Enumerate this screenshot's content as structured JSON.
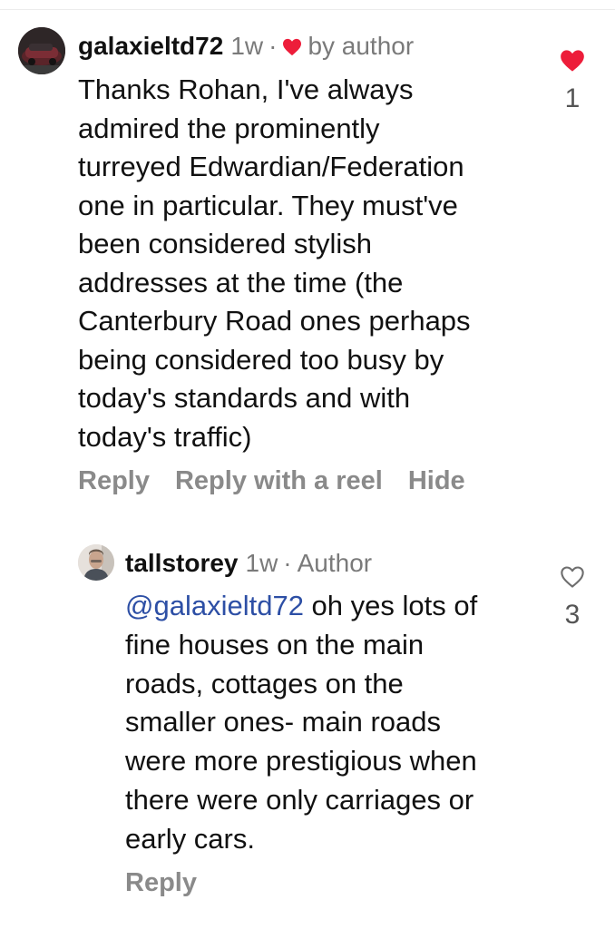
{
  "colors": {
    "like_active": "#ed1d3a",
    "secondary_text": "#7a7a7a",
    "mention_link": "#2d4fa5"
  },
  "comments": [
    {
      "username": "galaxieltd72",
      "time": "1w",
      "separator": "·",
      "author_like_icon": "heart-filled-icon",
      "author_like_label": "by author",
      "body_lines": [
        "Thanks Rohan, I've always",
        "admired the prominently",
        "turreyed Edwardian/Federation",
        "one in particular. They must've",
        "been considered stylish",
        "addresses at the time (the",
        "Canterbury Road ones perhaps",
        "being considered too busy by",
        "today's standards and with",
        "today's traffic)"
      ],
      "actions": [
        "Reply",
        "Reply with a reel",
        "Hide"
      ],
      "like_icon": "heart-filled-icon",
      "like_count": "1"
    },
    {
      "username": "tallstorey",
      "time": "1w",
      "separator": "·",
      "badge": "Author",
      "mention": "@galaxieltd72",
      "body_lines": [
        " oh yes lots of",
        "fine houses on the main",
        "roads, cottages on the",
        "smaller ones- main roads",
        "were more prestigious when",
        "there were only carriages or",
        "early cars."
      ],
      "actions": [
        "Reply"
      ],
      "like_icon": "heart-outline-icon",
      "like_count": "3"
    }
  ]
}
